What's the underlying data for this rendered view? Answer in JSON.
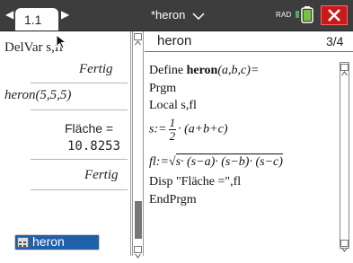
{
  "topbar": {
    "tab_label": "1.1",
    "document_title": "*heron",
    "angle_mode": "RAD"
  },
  "calculator": {
    "history": [
      {
        "input": "DelVar s,fl",
        "result": "Fertig"
      },
      {
        "input": "heron(5,5,5)",
        "output_line1": "Fläche =",
        "output_line2": "10.8253",
        "result": "Fertig"
      }
    ],
    "program_button_label": "heron"
  },
  "editor": {
    "program_name": "heron",
    "line_count": "3/4",
    "lines": {
      "define_prefix": "Define ",
      "define_name": "heron",
      "define_params": "(a,b,c)=",
      "prgm": "Prgm",
      "local": "Local s,fl",
      "s_assign_prefix": "s:=",
      "s_fraction_num": "1",
      "s_fraction_den": "2",
      "s_assign_rest": "· (a+b+c)",
      "fl_assign_prefix": "fl:=",
      "fl_sqrt_body": "s· (s−a)· (s−b)· (s−c)",
      "disp": "Disp \"Fläche =\",fl",
      "endprgm": "EndPrgm"
    }
  },
  "icons": [
    "tab-left-arrow-icon",
    "tab-right-arrow-icon",
    "cursor-icon",
    "chevron-down-icon",
    "battery-icon",
    "close-icon",
    "program-icon",
    "scroll-up-icon",
    "scroll-down-icon"
  ],
  "colors": {
    "topbar_bg": "#3d3d3d",
    "close_bg": "#c81a1a",
    "pill_bg": "#2060a8"
  }
}
